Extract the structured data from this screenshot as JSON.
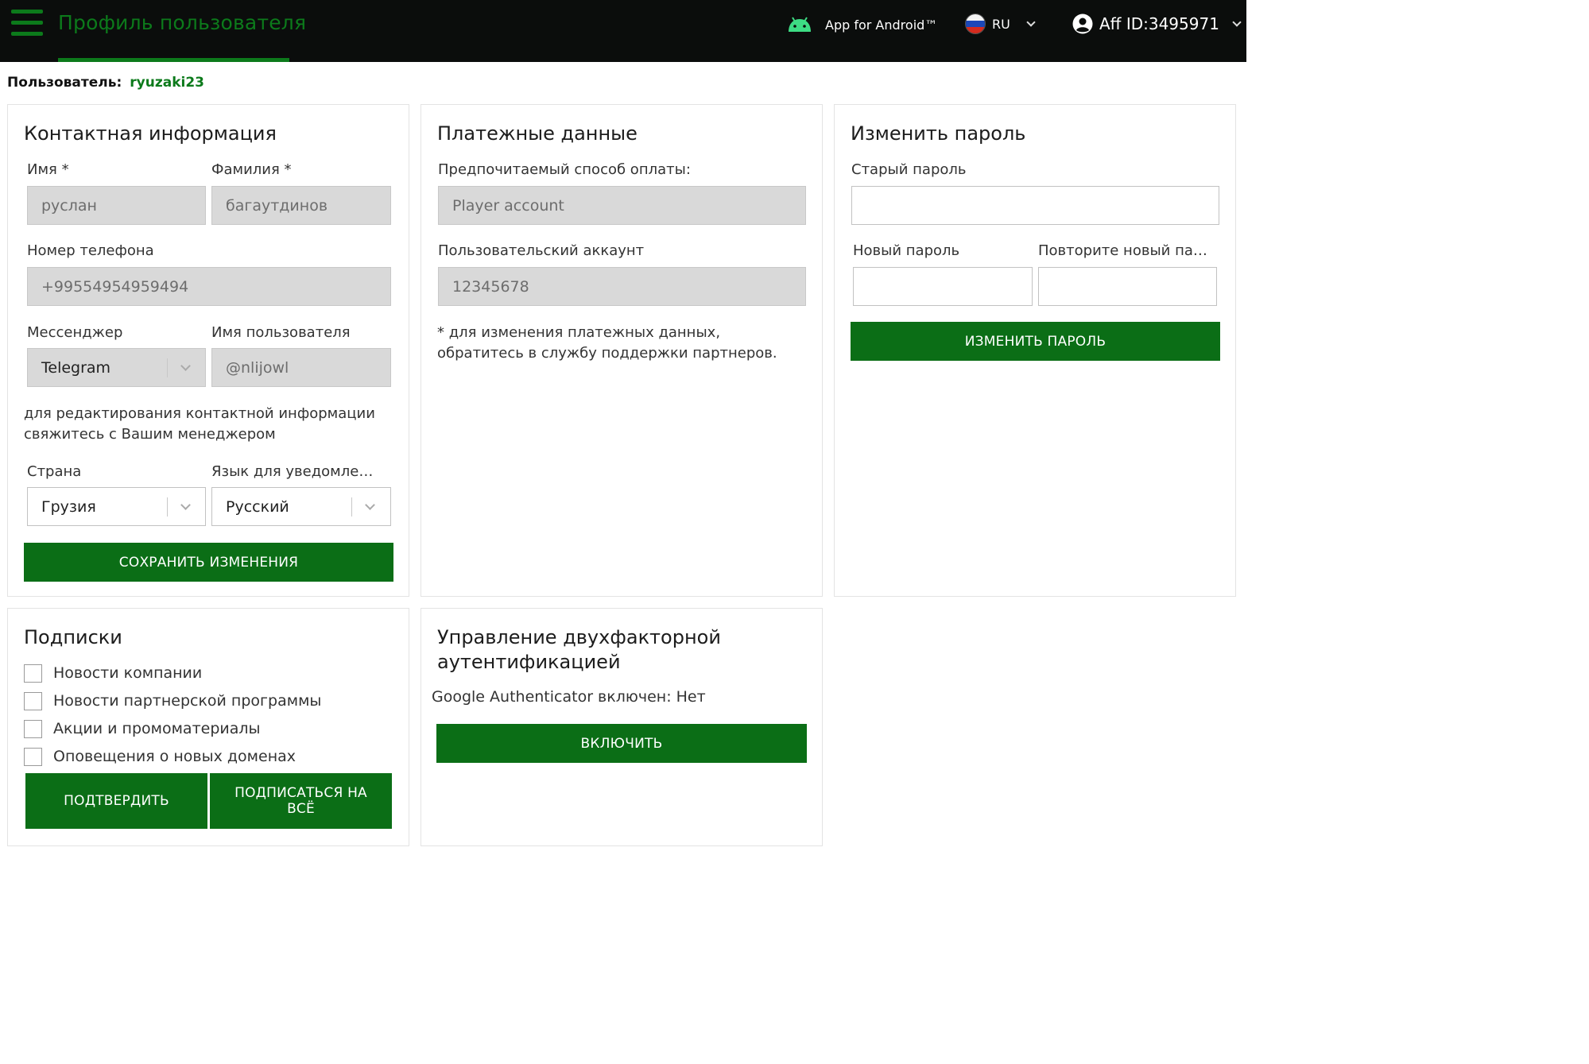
{
  "header": {
    "title": "Профиль пользователя",
    "android_label": "App for Android™",
    "lang_label": "RU",
    "account_label": "Aff ID:3495971",
    "icons": {
      "menu": "hamburger-icon",
      "android": "android-icon",
      "flag": "russia-flag-icon",
      "account": "account-circle-icon"
    }
  },
  "user": {
    "label": "Пользователь:",
    "name": "ryuzaki23"
  },
  "contact": {
    "title": "Контактная информация",
    "first_name_label": "Имя *",
    "first_name_value": "руслан",
    "last_name_label": "Фамилия *",
    "last_name_value": "багаутдинов",
    "phone_label": "Номер телефона",
    "phone_value": "+99554954959494",
    "messenger_label": "Мессенджер",
    "messenger_value": "Telegram",
    "username_label": "Имя пользователя",
    "username_value": "@nlijowl",
    "edit_note": "для редактирования контактной информации свяжитесь с Вашим менеджером",
    "country_label": "Страна",
    "country_value": "Грузия",
    "notify_lang_label": "Язык для уведомле…",
    "notify_lang_value": "Русский",
    "save_button": "СОХРАНИТЬ ИЗМЕНЕНИЯ"
  },
  "payment": {
    "title": "Платежные данные",
    "method_label": "Предпочитаемый способ оплаты:",
    "method_value": "Player account",
    "account_label": "Пользовательский аккаунт",
    "account_value": "12345678",
    "note": "* для изменения платежных данных, обратитесь в службу поддержки партнеров."
  },
  "password": {
    "title": "Изменить пароль",
    "old_label": "Старый пароль",
    "new_label": "Новый пароль",
    "repeat_label": "Повторите новый па…",
    "button": "ИЗМЕНИТЬ ПАРОЛЬ"
  },
  "subscriptions": {
    "title": "Подписки",
    "items": [
      {
        "label": "Новости компании",
        "checked": false
      },
      {
        "label": "Новости партнерской программы",
        "checked": false
      },
      {
        "label": "Акции и промоматериалы",
        "checked": false
      },
      {
        "label": "Оповещения о новых доменах",
        "checked": false
      }
    ],
    "confirm_button": "ПОДТВЕРДИТЬ",
    "subscribe_all_button": "ПОДПИСАТЬСЯ НА ВСЁ"
  },
  "two_factor": {
    "title": "Управление двухфакторной аутентификацией",
    "status_text": "Google Authenticator включен: Нет",
    "enable_button": "ВКЛЮЧИТЬ"
  },
  "colors": {
    "accent": "#0b6e16",
    "header_bg": "#0b0d0c",
    "title_green": "#0c7a1b"
  }
}
